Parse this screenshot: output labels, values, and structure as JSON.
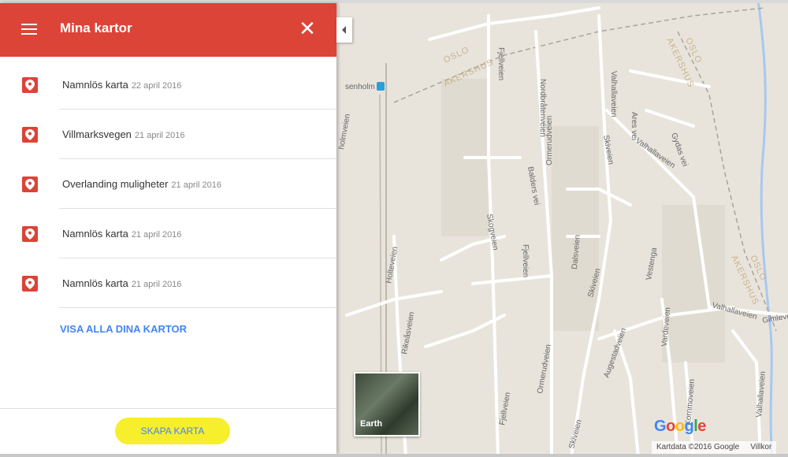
{
  "header": {
    "title": "Mina kartor"
  },
  "icons": {
    "menu": "hamburger-menu-icon",
    "close": "close-icon",
    "pin": "map-pin-icon",
    "collapse": "chevron-left-icon"
  },
  "colors": {
    "header_red": "#db4437",
    "link_blue": "#4285f4",
    "highlight_yellow": "#f7ee2c"
  },
  "maps": [
    {
      "name": "Namnlös karta",
      "date": "22 april 2016"
    },
    {
      "name": "Villmarksvegen",
      "date": "21 april 2016"
    },
    {
      "name": "Overlanding muligheter",
      "date": "21 april 2016"
    },
    {
      "name": "Namnlös karta",
      "date": "21 april 2016"
    },
    {
      "name": "Namnlös karta",
      "date": "21 april 2016"
    }
  ],
  "view_all_label": "VISA ALLA DINA KARTOR",
  "create_map_label": "SKAPA KARTA",
  "map": {
    "earth_label": "Earth",
    "logo": [
      "G",
      "o",
      "o",
      "g",
      "l",
      "e"
    ],
    "attribution": "Kartdata ©2016 Google",
    "terms": "Villkor",
    "place_labels": {
      "station": "senholm",
      "oslo1": "OSLO",
      "akershus1": "AKERSHUS",
      "oslo2": "OSLO",
      "akershus2": "AKERSHUS",
      "oslo3": "OSLO",
      "akershus3": "AKERSHUS"
    },
    "road_labels": {
      "fjellveien1": "Fjellveien",
      "nordbraten": "Nordbråtenveien",
      "valhallaveien1": "Valhallaveien",
      "aresvei": "Ares vei",
      "gydasvei": "Gydas vei",
      "valhallaveien2": "Valhallaveien",
      "ormerudveien1": "Ormerudveien",
      "skiveien1": "Skiveien",
      "baldersvei": "Balders vei",
      "skogveien": "Skogveien",
      "fjellveien2": "Fjellveien",
      "dalsveien": "Dalsveien",
      "skiveien2": "Skiveien",
      "vestenga": "Vestenga",
      "holteveien": "Holteveien",
      "rikeasveien": "Rikeåsveien",
      "ormerudveien2": "Ormerudveien",
      "augestadveien": "Augestadveien",
      "vardeveien": "Vardeveien",
      "valhallaveien3": "Valhallaveien",
      "gimleveien": "Gimleve",
      "fjellveien3": "Fjellveien",
      "skiveien3": "Skiveien",
      "kornmoveien": "Kornmoveien",
      "valhallaveien4": "Valhallaveien",
      "holmveien": "holmveien"
    }
  }
}
